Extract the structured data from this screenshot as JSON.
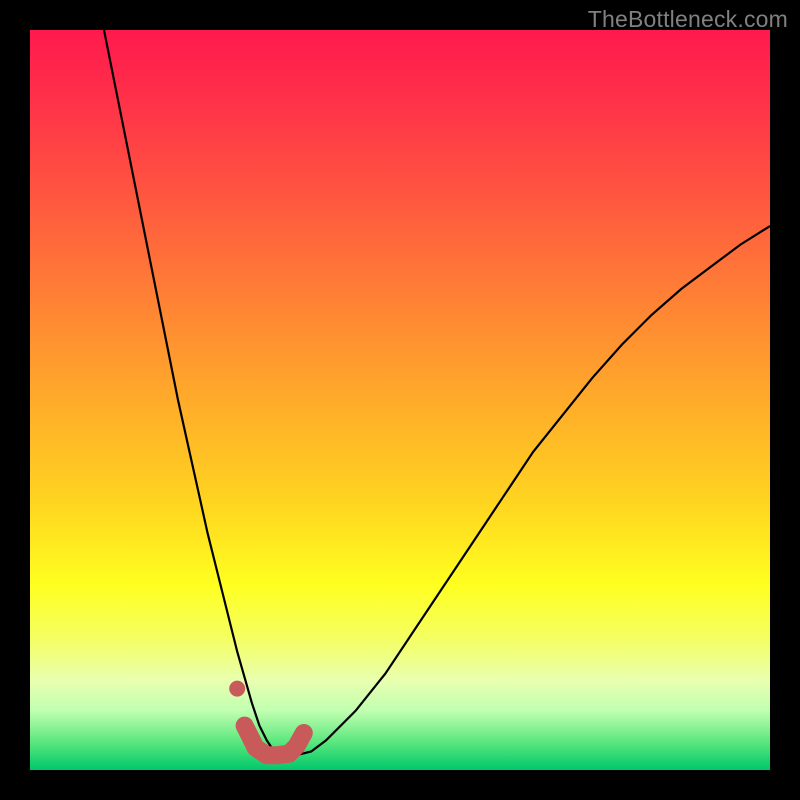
{
  "watermark": "TheBottleneck.com",
  "colors": {
    "frame": "#000000",
    "curve_stroke": "#000000",
    "marker_stroke": "#c85a5a",
    "marker_fill": "#c85a5a"
  },
  "chart_data": {
    "type": "line",
    "title": "",
    "xlabel": "",
    "ylabel": "",
    "x_range": [
      0,
      100
    ],
    "y_range": [
      0,
      100
    ],
    "grid": false,
    "legend": false,
    "series": [
      {
        "name": "bottleneck-curve",
        "x": [
          10,
          12,
          14,
          16,
          18,
          20,
          22,
          24,
          26,
          28,
          30,
          31,
          32,
          33,
          34,
          36,
          38,
          40,
          44,
          48,
          52,
          56,
          60,
          64,
          68,
          72,
          76,
          80,
          84,
          88,
          92,
          96,
          100
        ],
        "y": [
          100,
          90,
          80,
          70,
          60,
          50,
          41,
          32,
          24,
          16,
          9,
          6,
          4,
          2.5,
          2,
          2,
          2.5,
          4,
          8,
          13,
          19,
          25,
          31,
          37,
          43,
          48,
          53,
          57.5,
          61.5,
          65,
          68,
          71,
          73.5
        ]
      }
    ],
    "highlight_markers": {
      "name": "selected-range",
      "x": [
        28,
        29,
        30.5,
        32,
        33.5,
        35,
        36,
        37
      ],
      "y": [
        11,
        6,
        3,
        2,
        2,
        2.2,
        3.2,
        5
      ]
    },
    "gradient_stops": [
      {
        "pos": 0.0,
        "color": "#ff1a4d"
      },
      {
        "pos": 0.5,
        "color": "#ffd520"
      },
      {
        "pos": 0.82,
        "color": "#f5ff60"
      },
      {
        "pos": 1.0,
        "color": "#00c86a"
      }
    ]
  }
}
